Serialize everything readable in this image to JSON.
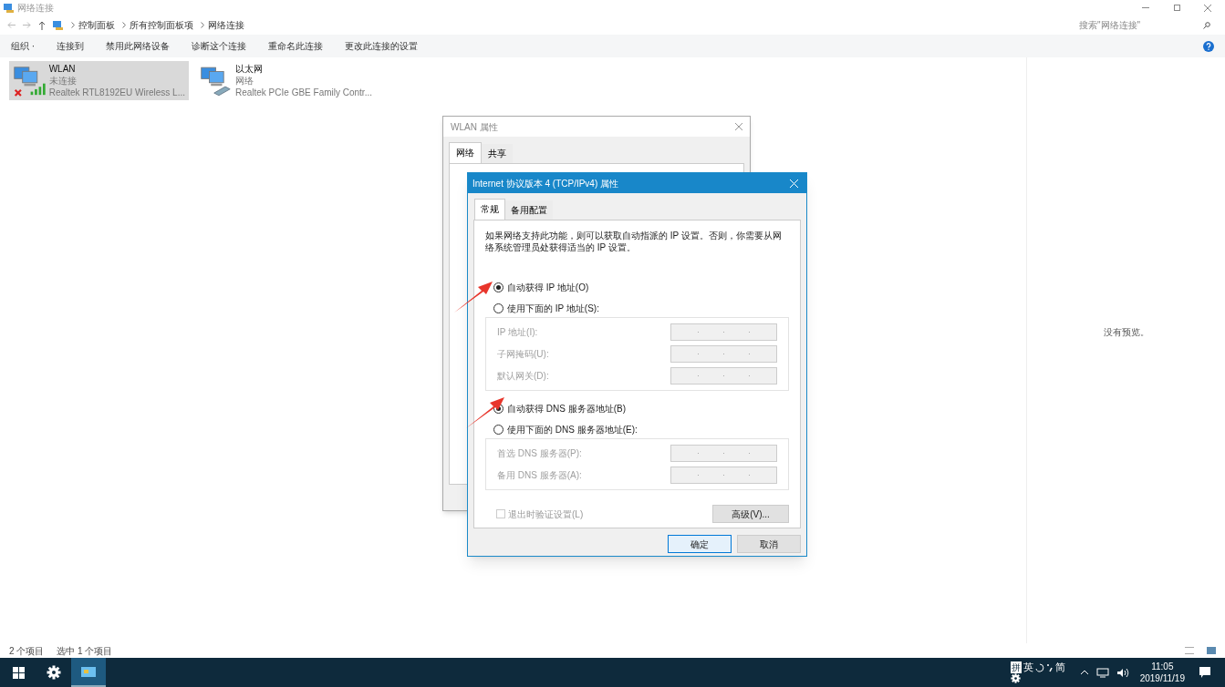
{
  "window": {
    "title": "网络连接",
    "breadcrumbs": [
      "控制面板",
      "所有控制面板项",
      "网络连接"
    ],
    "search": {
      "placeholder": "搜索\"网络连接\""
    },
    "toolbar": [
      "组织 ·",
      "连接到",
      "禁用此网络设备",
      "诊断这个连接",
      "重命名此连接",
      "更改此连接的设置"
    ],
    "connections": [
      {
        "kind": "wireless",
        "name": "WLAN",
        "status": "未连接",
        "device": "Realtek RTL8192EU Wireless L...",
        "selected": true
      },
      {
        "kind": "ethernet",
        "name": "以太网",
        "status": "网络",
        "device": "Realtek PCIe GBE Family Contr...",
        "selected": false
      }
    ],
    "preview_text": "没有预览。",
    "status_bar": {
      "count": "2 个项目",
      "selection": "选中 1 个项目"
    }
  },
  "wlan_dialog": {
    "title": "WLAN 属性",
    "tabs": [
      {
        "label": "网络",
        "selected": true
      },
      {
        "label": "共享",
        "selected": false
      }
    ]
  },
  "ipv4_dialog": {
    "title": "Internet 协议版本 4 (TCP/IPv4) 属性",
    "tabs": [
      {
        "label": "常规",
        "selected": true
      },
      {
        "label": "备用配置",
        "selected": false
      }
    ],
    "description": "如果网络支持此功能，则可以获取自动指派的 IP 设置。否则，你需要从网络系统管理员处获得适当的 IP 设置。",
    "ip_options": [
      {
        "label": "自动获得 IP 地址(O)",
        "selected": true
      },
      {
        "label": "使用下面的 IP 地址(S):",
        "selected": false
      }
    ],
    "ip_fields": [
      {
        "label": "IP 地址(I):",
        "disabled": true
      },
      {
        "label": "子网掩码(U):",
        "disabled": true
      },
      {
        "label": "默认网关(D):",
        "disabled": true
      }
    ],
    "dns_options": [
      {
        "label": "自动获得 DNS 服务器地址(B)",
        "selected": true
      },
      {
        "label": "使用下面的 DNS 服务器地址(E):",
        "selected": false
      }
    ],
    "dns_fields": [
      {
        "label": "首选 DNS 服务器(P):",
        "disabled": true
      },
      {
        "label": "备用 DNS 服务器(A):",
        "disabled": true
      }
    ],
    "validate": {
      "label": "退出时验证设置(L)",
      "checked": false,
      "disabled": true
    },
    "advanced": "高级(V)...",
    "buttons": [
      "确定",
      "取消"
    ]
  },
  "taskbar": {
    "ime": [
      "拼",
      "英",
      "简"
    ],
    "time": "11:05",
    "date": "2019/11/19"
  }
}
